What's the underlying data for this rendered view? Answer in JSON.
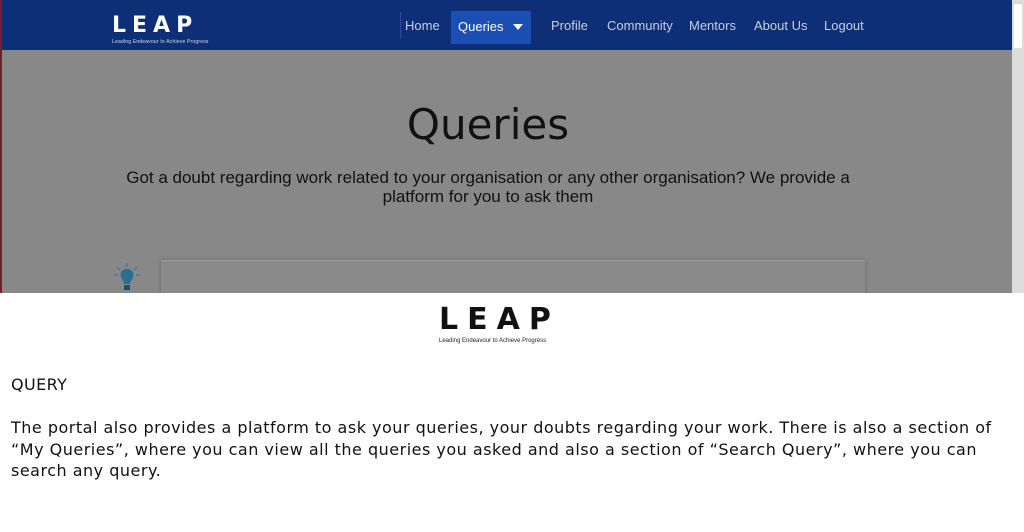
{
  "brand": {
    "logo_text": "LEAP",
    "tagline": "Leading Endeavour to Achieve Progress"
  },
  "nav": {
    "items": [
      {
        "label": "Home"
      },
      {
        "label": "Queries",
        "active": true
      },
      {
        "label": "Profile"
      },
      {
        "label": "Community"
      },
      {
        "label": "Mentors"
      },
      {
        "label": "About Us"
      },
      {
        "label": "Logout"
      }
    ]
  },
  "page": {
    "title": "Queries",
    "subtitle": "Got a doubt regarding work related to your organisation or any other organisation? We provide a platform for you to ask them"
  },
  "description": {
    "heading": "QUERY",
    "body": "The portal also provides a platform to ask your queries, your doubts regarding your work. There is also a section of “My Queries”, where you can view all the queries you asked and also a section of “Search Query”, where you can search any query."
  },
  "colors": {
    "navbar": "#0e2e78",
    "nav_active": "#1b4fb3",
    "overlay": "#888888"
  },
  "icons": {
    "bulb": "lightbulb-icon",
    "dropdown": "chevron-down-icon"
  }
}
